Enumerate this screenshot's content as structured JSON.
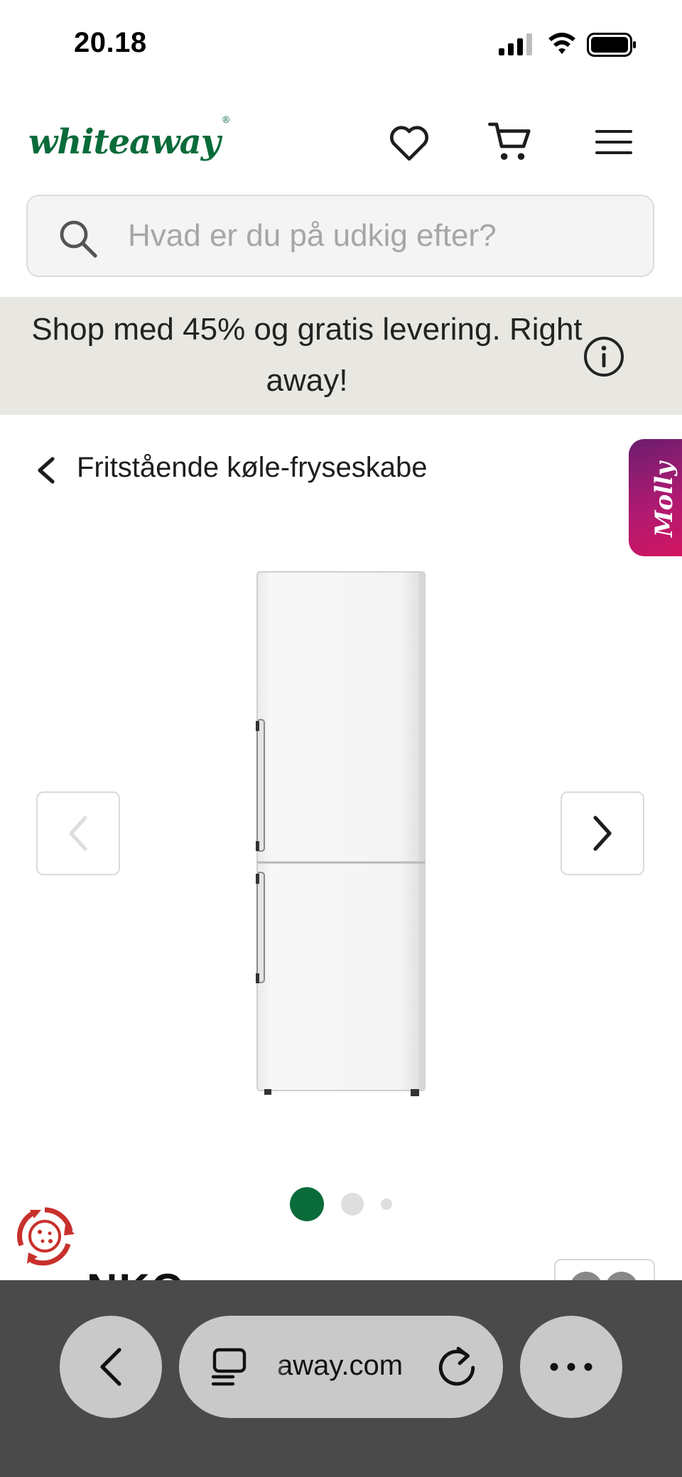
{
  "status_bar": {
    "time": "20.18",
    "icons": [
      "signal-icon",
      "wifi-icon",
      "battery-icon"
    ]
  },
  "header": {
    "logo_text": "whiteaway",
    "logo_mark": "®",
    "icons": [
      "heart-icon",
      "cart-icon",
      "menu-icon"
    ]
  },
  "search": {
    "placeholder": "Hvad er du på udkig efter?",
    "value": ""
  },
  "promo": {
    "text": "Shop med 45% og gratis levering. Right away!"
  },
  "breadcrumb": {
    "label": "Fritstående køle-fryseskabe"
  },
  "assistant_tab": {
    "label": "Molly"
  },
  "gallery": {
    "image_count": 3,
    "active_index": 0
  },
  "product_peek": {
    "brand_partial": "NKO"
  },
  "browser": {
    "url": "away.com"
  },
  "colors": {
    "brand_green": "#0a6b3a",
    "promo_bg": "#e8e7e2",
    "molly_gradient_start": "#6b1d6e",
    "molly_gradient_end": "#d4145f",
    "dot_active": "#0a6b3a",
    "dot_inactive": "#dedede",
    "browser_bar": "#4a4a4a",
    "browser_pill": "#c9c9c9",
    "cookie_red": "#c8302c"
  }
}
